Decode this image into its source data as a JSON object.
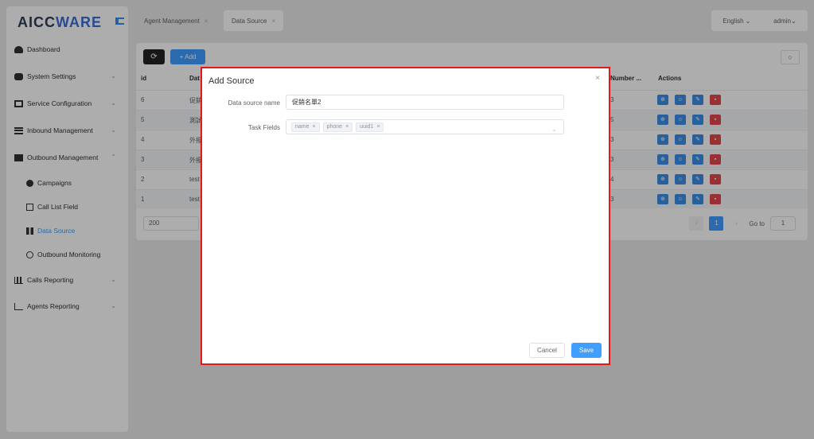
{
  "logo": {
    "part1": "AICC",
    "part2": "WARE"
  },
  "sidebar": {
    "items": [
      {
        "label": "Dashboard",
        "icon": "dashboard-icon",
        "chevron": ""
      },
      {
        "label": "System Settings",
        "icon": "users-cog-icon",
        "chevron": "⌄"
      },
      {
        "label": "Service Configuration",
        "icon": "id-card-icon",
        "chevron": "⌄"
      },
      {
        "label": "Inbound Management",
        "icon": "list-icon",
        "chevron": "⌄"
      },
      {
        "label": "Outbound Management",
        "icon": "table-icon",
        "chevron": "⌃"
      },
      {
        "label": "Campaigns",
        "icon": "gear-icon"
      },
      {
        "label": "Call List Field",
        "icon": "list-box-icon"
      },
      {
        "label": "Data Source",
        "icon": "grid-icon"
      },
      {
        "label": "Outbound Monitoring",
        "icon": "refresh-icon"
      },
      {
        "label": "Calls Reporting",
        "icon": "bar-chart-icon",
        "chevron": "⌄"
      },
      {
        "label": "Agents Reporting",
        "icon": "line-chart-icon",
        "chevron": "⌄"
      }
    ]
  },
  "tabs": [
    {
      "label": "Agent Management",
      "close": "×"
    },
    {
      "label": "Data Source",
      "close": "×"
    }
  ],
  "header": {
    "language": "English ⌄",
    "user": "admin⌄"
  },
  "toolbar": {
    "refresh": "⟳",
    "add_label": "+ Add",
    "search": "○"
  },
  "table": {
    "headers": {
      "id": "id",
      "data": "Dat",
      "number": "Number ...",
      "actions": "Actions"
    },
    "rows": [
      {
        "id": "6",
        "name": "促銷",
        "number": "3"
      },
      {
        "id": "5",
        "name": "測試",
        "number": "5"
      },
      {
        "id": "4",
        "name": "外撥",
        "number": "3"
      },
      {
        "id": "3",
        "name": "外撥",
        "number": "3"
      },
      {
        "id": "2",
        "name": "test",
        "number": "4"
      },
      {
        "id": "1",
        "name": "test",
        "number": "3"
      }
    ]
  },
  "pagination": {
    "page_size": "200",
    "current_page": "1",
    "goto_label": "Go to",
    "goto_value": "1"
  },
  "modal": {
    "title": "Add Source",
    "close": "×",
    "name_label": "Data source name",
    "name_value": "促銷名單2",
    "fields_label": "Task Fields",
    "tags": [
      "name",
      "phone",
      "uuid1"
    ],
    "cancel_label": "Cancel",
    "save_label": "Save"
  },
  "colors": {
    "primary": "#409eff",
    "danger": "#e5484d",
    "highlight_border": "#e01a1a"
  }
}
